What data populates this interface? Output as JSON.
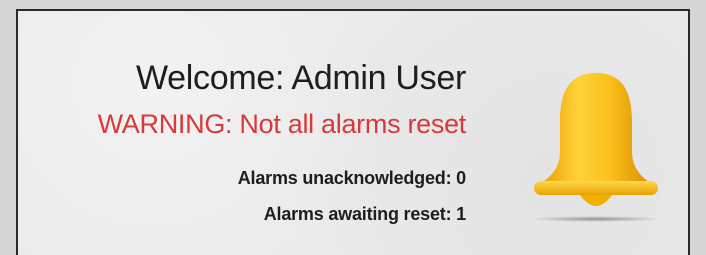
{
  "welcome": "Welcome: Admin User",
  "warning": "WARNING: Not all alarms reset",
  "stats": {
    "unacknowledged": "Alarms unacknowledged: 0",
    "awaiting_reset": "Alarms awaiting reset: 1"
  },
  "icon": {
    "name": "bell-icon",
    "color": "#F5B400"
  },
  "colors": {
    "warning": "#D83A3A",
    "text": "#1E1E1E",
    "background": "#EBEBEB"
  }
}
